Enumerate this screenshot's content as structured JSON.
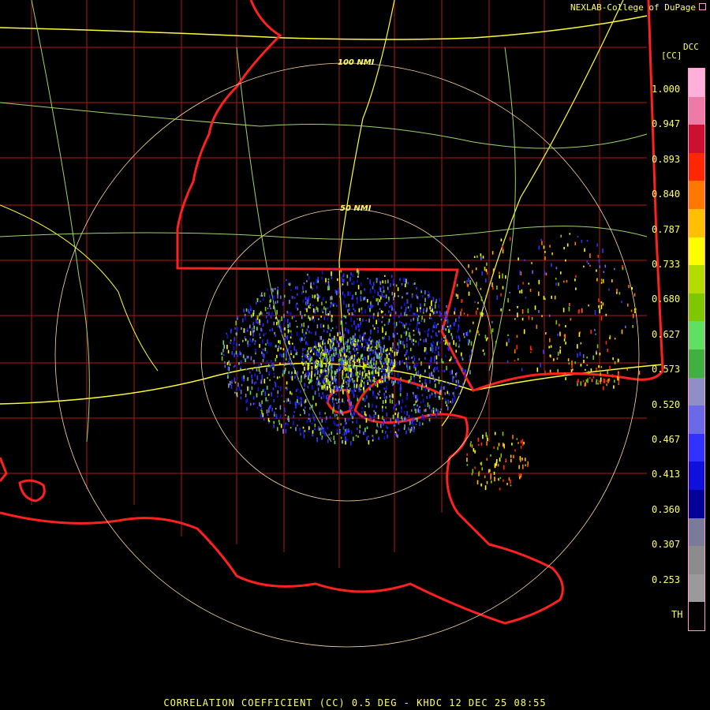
{
  "credit": "NEXLAB-College of DuPage",
  "legend": {
    "product": "DCC",
    "unit": "[CC]",
    "ticks": [
      "1.000",
      "0.947",
      "0.893",
      "0.840",
      "0.787",
      "0.733",
      "0.680",
      "0.627",
      "0.573",
      "0.520",
      "0.467",
      "0.413",
      "0.360",
      "0.307",
      "0.253",
      "TH"
    ],
    "colors": [
      "#ffb0d8",
      "#ee7aa8",
      "#cc1030",
      "#ff2800",
      "#ff7800",
      "#ffc000",
      "#ffff00",
      "#b4dc00",
      "#7ec800",
      "#60e060",
      "#40b040",
      "#8f8fc8",
      "#6a6ae8",
      "#3232ff",
      "#1010dd",
      "#000099",
      "#7a7a9a",
      "#8c8c8c",
      "#9a9a9a",
      "#000000"
    ]
  },
  "rings": [
    "100 NMI",
    "50 NMI"
  ],
  "footer": "CORRELATION COEFFICIENT (CC) 0.5 DEG - KHDC 12 DEC 25 08:55",
  "icons": {
    "credit": "expand-icon"
  }
}
